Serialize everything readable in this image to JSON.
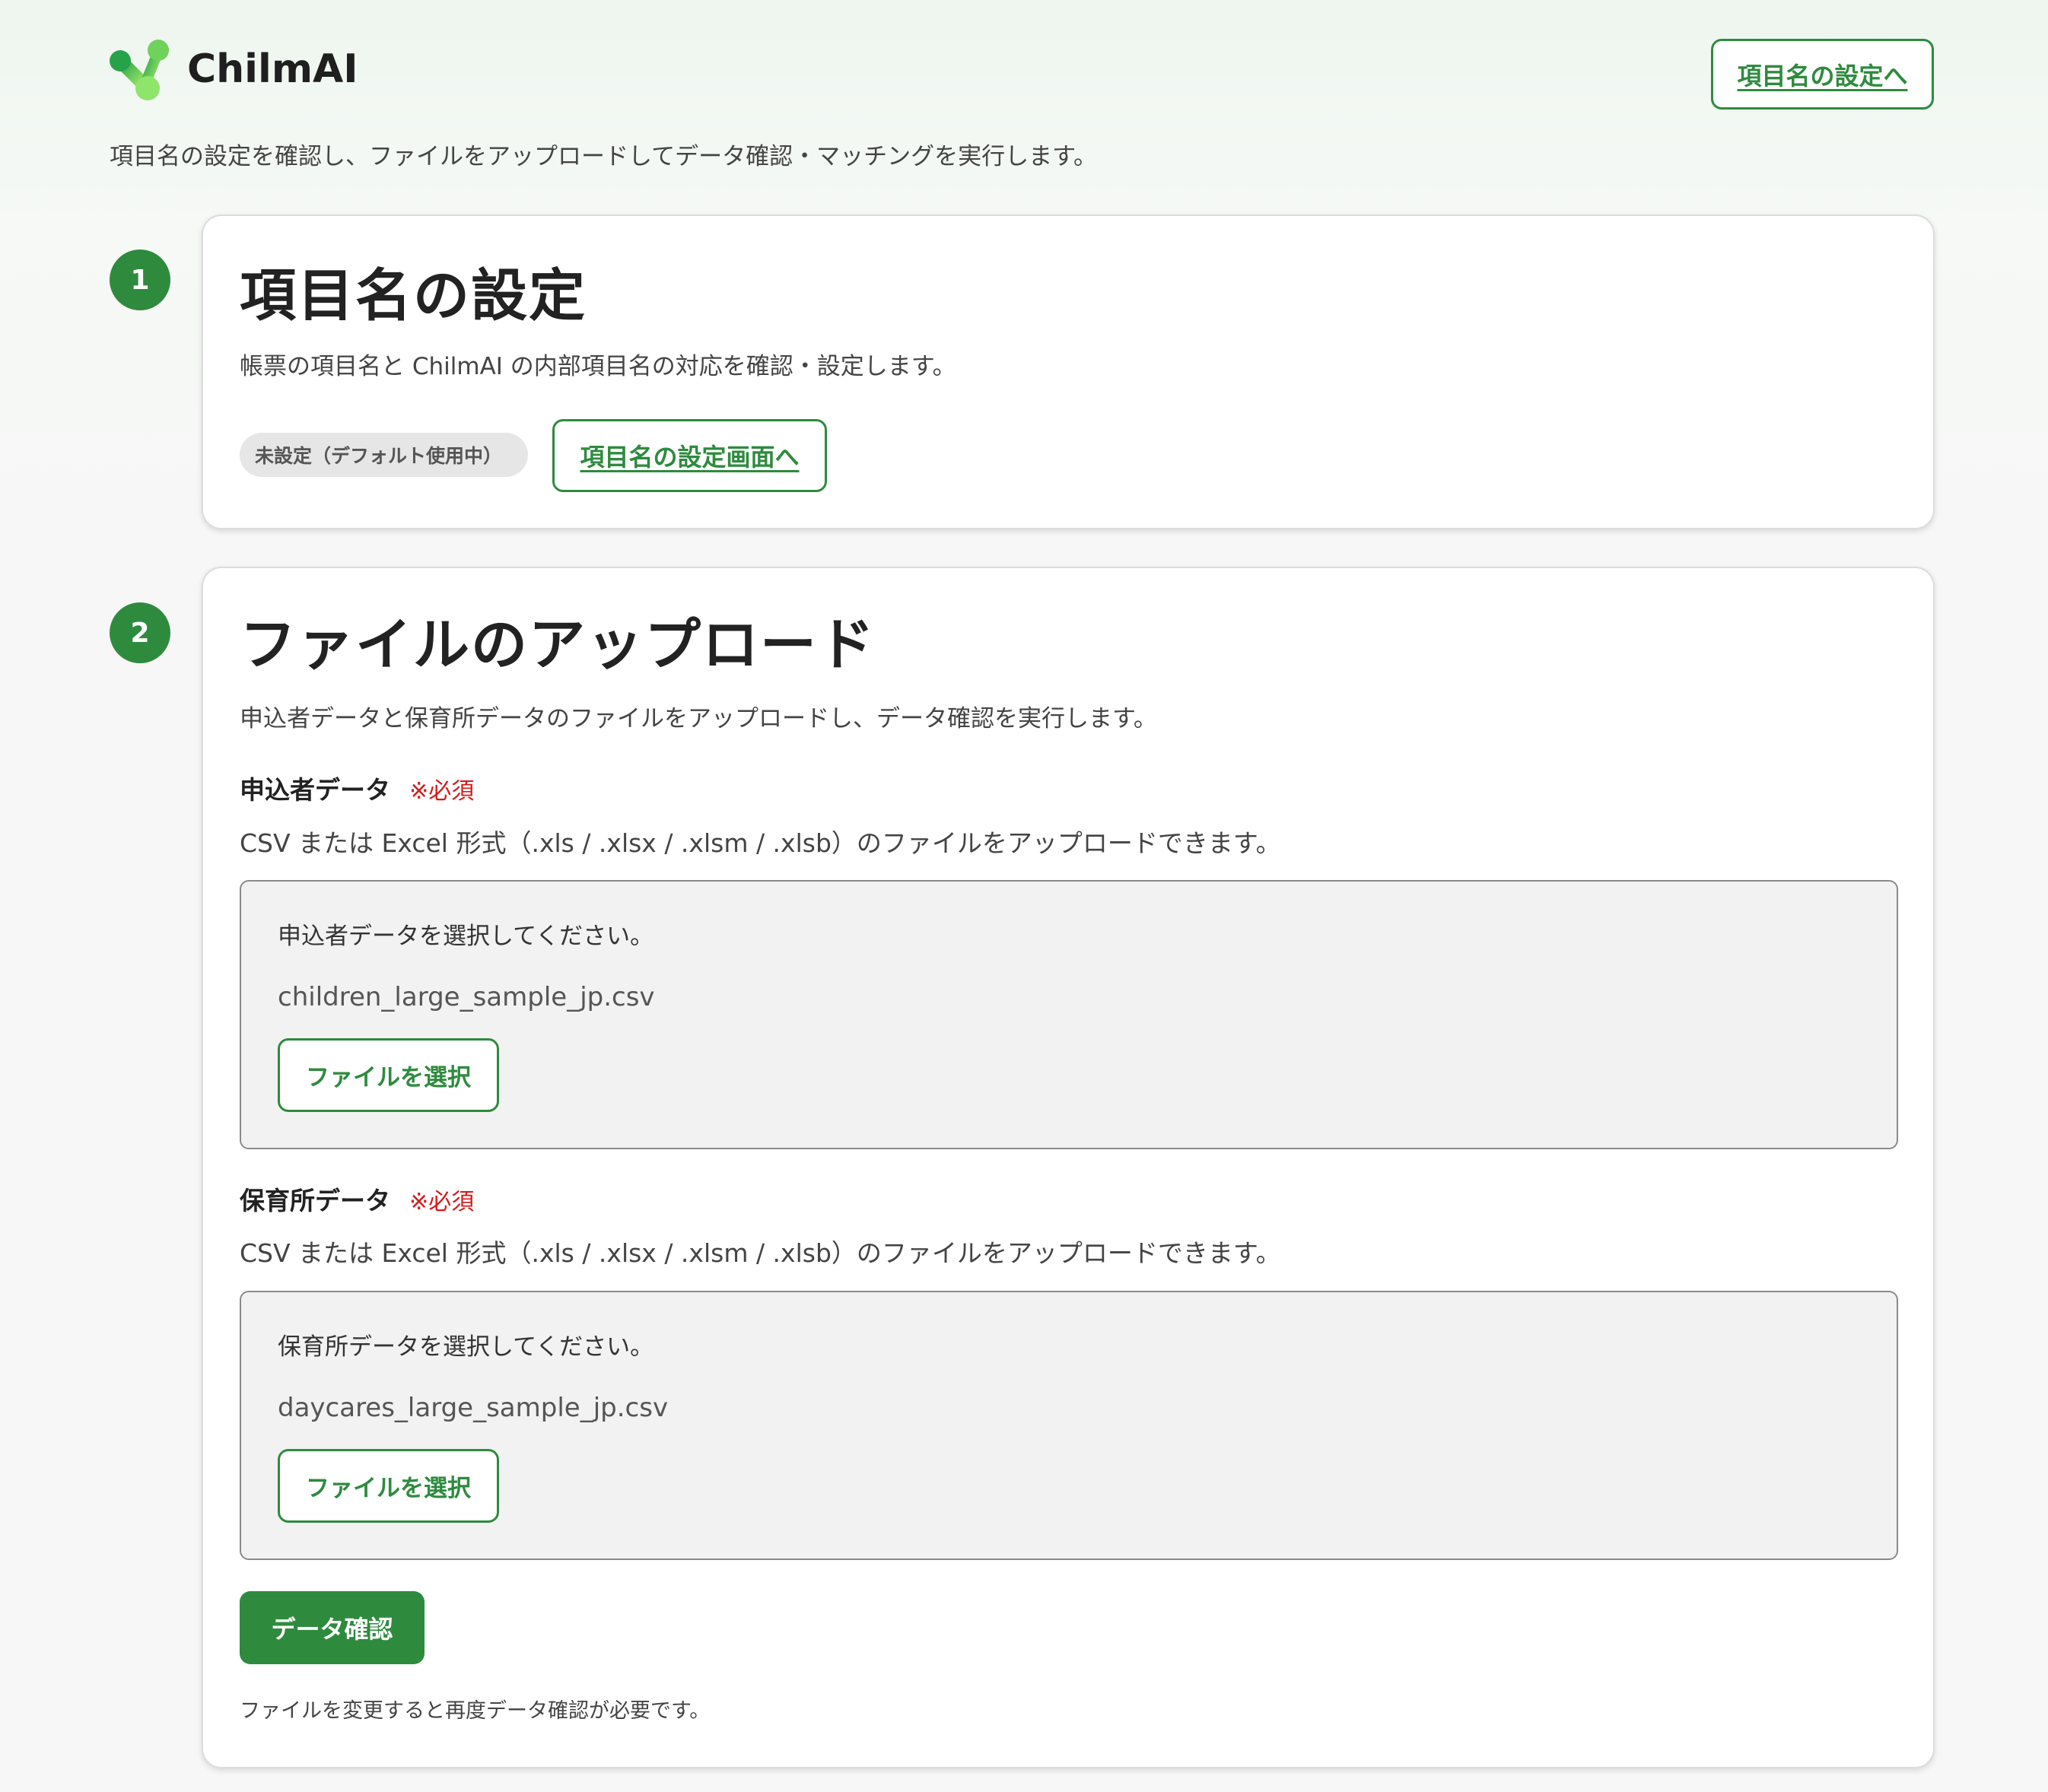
{
  "header": {
    "brand_name": "ChilmAI",
    "settings_link_label": "項目名の設定へ",
    "intro_text": "項目名の設定を確認し、ファイルをアップロードしてデータ確認・マッチングを実行します。"
  },
  "steps": [
    {
      "number": "1",
      "title": "項目名の設定",
      "description": "帳票の項目名と ChilmAI の内部項目名の対応を確認・設定します。",
      "status_badge": "未設定（デフォルト使用中）",
      "button_label": "項目名の設定画面へ"
    },
    {
      "number": "2",
      "title": "ファイルのアップロード",
      "description": "申込者データと保育所データのファイルをアップロードし、データ確認を実行します。",
      "uploads": [
        {
          "label": "申込者データ",
          "required": "※必須",
          "hint": "CSV または Excel 形式（.xls / .xlsx / .xlsm / .xlsb）のファイルをアップロードできます。",
          "prompt": "申込者データを選択してください。",
          "filename": "children_large_sample_jp.csv",
          "button_label": "ファイルを選択"
        },
        {
          "label": "保育所データ",
          "required": "※必須",
          "hint": "CSV または Excel 形式（.xls / .xlsx / .xlsm / .xlsb）のファイルをアップロードできます。",
          "prompt": "保育所データを選択してください。",
          "filename": "daycares_large_sample_jp.csv",
          "button_label": "ファイルを選択"
        }
      ],
      "confirm_button_label": "データ確認",
      "footer_note": "ファイルを変更すると再度データ確認が必要です。"
    }
  ],
  "colors": {
    "accent": "#2e8b3e",
    "required": "#d41a1a",
    "logo_gradient": [
      "#2fa84a",
      "#9be86a"
    ]
  },
  "icons": {
    "logo": "molecule-logo-icon"
  }
}
